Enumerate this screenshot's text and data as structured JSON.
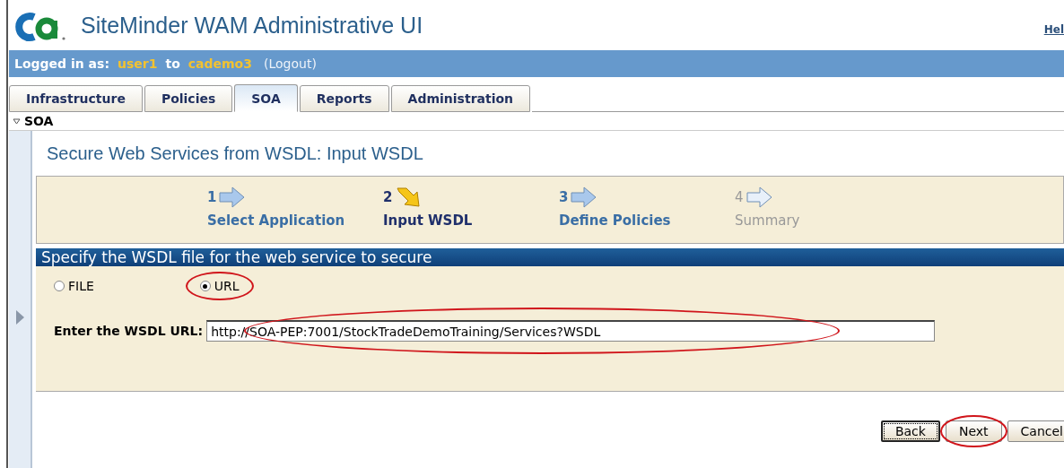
{
  "header": {
    "title": "SiteMinder WAM Administrative UI",
    "help_link": "Hel"
  },
  "login_bar": {
    "label": "Logged in as:",
    "user": "user1",
    "connector": "to",
    "server": "cademo3",
    "logout": "(Logout)"
  },
  "tabs": [
    {
      "label": "Infrastructure",
      "selected": false
    },
    {
      "label": "Policies",
      "selected": false
    },
    {
      "label": "SOA",
      "selected": true
    },
    {
      "label": "Reports",
      "selected": false
    },
    {
      "label": "Administration",
      "selected": false
    }
  ],
  "section": {
    "title": "SOA",
    "expanded": true
  },
  "page_title": "Secure Web Services from WSDL: Input WSDL",
  "steps": [
    {
      "number": "1",
      "label": "Select Application",
      "current": false,
      "disabled": false
    },
    {
      "number": "2",
      "label": "Input WSDL",
      "current": true,
      "disabled": false
    },
    {
      "number": "3",
      "label": "Define Policies",
      "current": false,
      "disabled": false
    },
    {
      "number": "4",
      "label": "Summary",
      "current": false,
      "disabled": true
    }
  ],
  "form": {
    "heading": "Specify the WSDL file for the web service to secure",
    "options": [
      {
        "label": "FILE",
        "selected": false,
        "highlighted": false
      },
      {
        "label": "URL",
        "selected": true,
        "highlighted": true
      }
    ],
    "url_label": "Enter the WSDL URL:",
    "url_value": "http://SOA-PEP:7001/StockTradeDemoTraining/Services?WSDL",
    "url_highlighted": true
  },
  "buttons": [
    {
      "label": "Back",
      "focused": true,
      "highlighted": false
    },
    {
      "label": "Next",
      "focused": false,
      "highlighted": true
    },
    {
      "label": "Cancel",
      "focused": false,
      "highlighted": false
    }
  ]
}
